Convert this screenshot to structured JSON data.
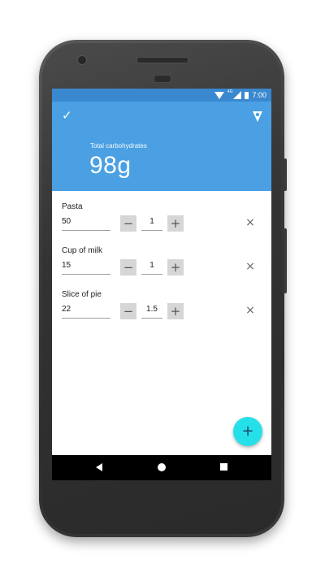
{
  "status_bar": {
    "network_badge": "4G",
    "time": "7:00",
    "icons": [
      "wifi-icon",
      "signal-icon",
      "battery-icon"
    ]
  },
  "header": {
    "confirm_icon": "check-icon",
    "confirm_glyph": "✓",
    "brand_icon": "brand-icon",
    "total_label": "Total carbohydrates",
    "total_value": "98g",
    "background_color": "#4aa0e2"
  },
  "foods": [
    {
      "name": "Pasta",
      "carbs": "50",
      "quantity": "1"
    },
    {
      "name": "Cup of milk",
      "carbs": "15",
      "quantity": "1"
    },
    {
      "name": "Slice of pie",
      "carbs": "22",
      "quantity": "1.5"
    }
  ],
  "controls": {
    "minus_glyph": "−",
    "plus_glyph": "+",
    "remove_glyph": "×"
  },
  "fab": {
    "glyph": "+",
    "color": "#25e0e8"
  },
  "nav_bar": {
    "icons": [
      "back-icon",
      "home-icon",
      "recent-apps-icon"
    ]
  }
}
